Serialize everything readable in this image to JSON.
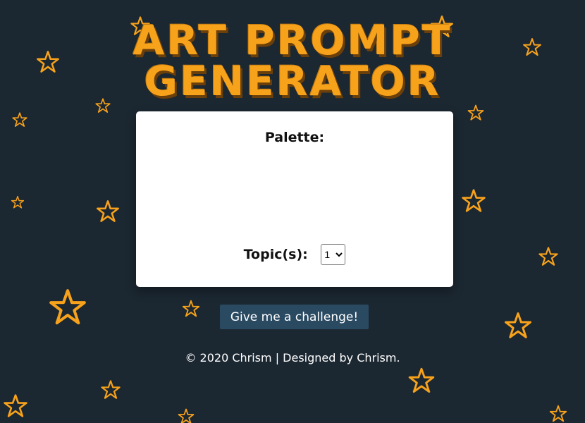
{
  "header": {
    "title_line1": "ART PROMPT",
    "title_line2": "GENERATOR"
  },
  "card": {
    "palette_label": "Palette:",
    "topic_label": "Topic(s):",
    "topic_selected": "1",
    "topic_options": [
      "1"
    ]
  },
  "actions": {
    "challenge_label": "Give me a challenge!"
  },
  "footer": {
    "text": "© 2020 Chrism | Designed by Chrism."
  },
  "colors": {
    "background": "#1b2731",
    "accent": "#f7a21b",
    "button": "#2a4a62",
    "card": "#ffffff"
  }
}
